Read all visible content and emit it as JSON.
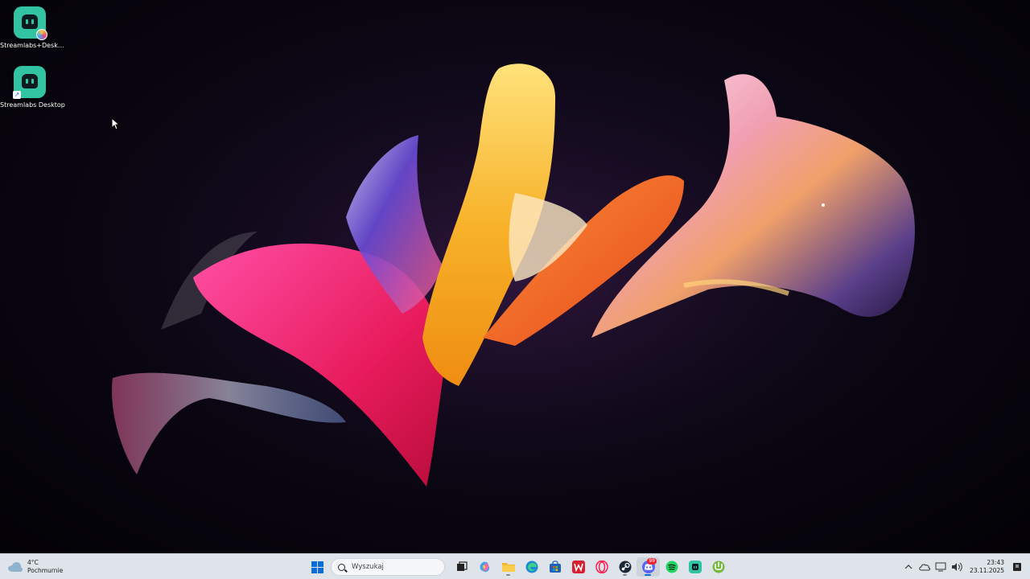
{
  "desktop": {
    "icons": [
      {
        "label": "Streamlabs+Desk...",
        "icon": "streamlabs-plus-icon"
      },
      {
        "label": "Streamlabs Desktop",
        "icon": "streamlabs-icon"
      }
    ]
  },
  "taskbar": {
    "weather": {
      "temp": "4°C",
      "condition": "Pochmurnie",
      "icon": "cloud-icon"
    },
    "search": {
      "placeholder": "Wyszukaj"
    },
    "apps": [
      {
        "name": "start",
        "icon": "windows-logo-icon"
      },
      {
        "name": "task-view",
        "icon": "task-view-icon"
      },
      {
        "name": "copilot",
        "icon": "copilot-icon"
      },
      {
        "name": "file-explorer",
        "icon": "folder-icon"
      },
      {
        "name": "edge",
        "icon": "edge-icon"
      },
      {
        "name": "store",
        "icon": "store-icon"
      },
      {
        "name": "wps",
        "icon": "wps-icon"
      },
      {
        "name": "opera-gx",
        "icon": "opera-icon"
      },
      {
        "name": "steam",
        "icon": "steam-icon"
      },
      {
        "name": "discord",
        "icon": "discord-icon",
        "badge": "99"
      },
      {
        "name": "spotify",
        "icon": "spotify-icon"
      },
      {
        "name": "streamlabs",
        "icon": "streamlabs-icon"
      },
      {
        "name": "utorrent",
        "icon": "utorrent-icon"
      }
    ],
    "clock": {
      "time": "23:43",
      "date": "23.11.2025"
    },
    "colors": {
      "taskbar_bg": "#dfe4ea",
      "accent": "#0a6cd6",
      "icon_teal": "#31c3a2"
    }
  }
}
